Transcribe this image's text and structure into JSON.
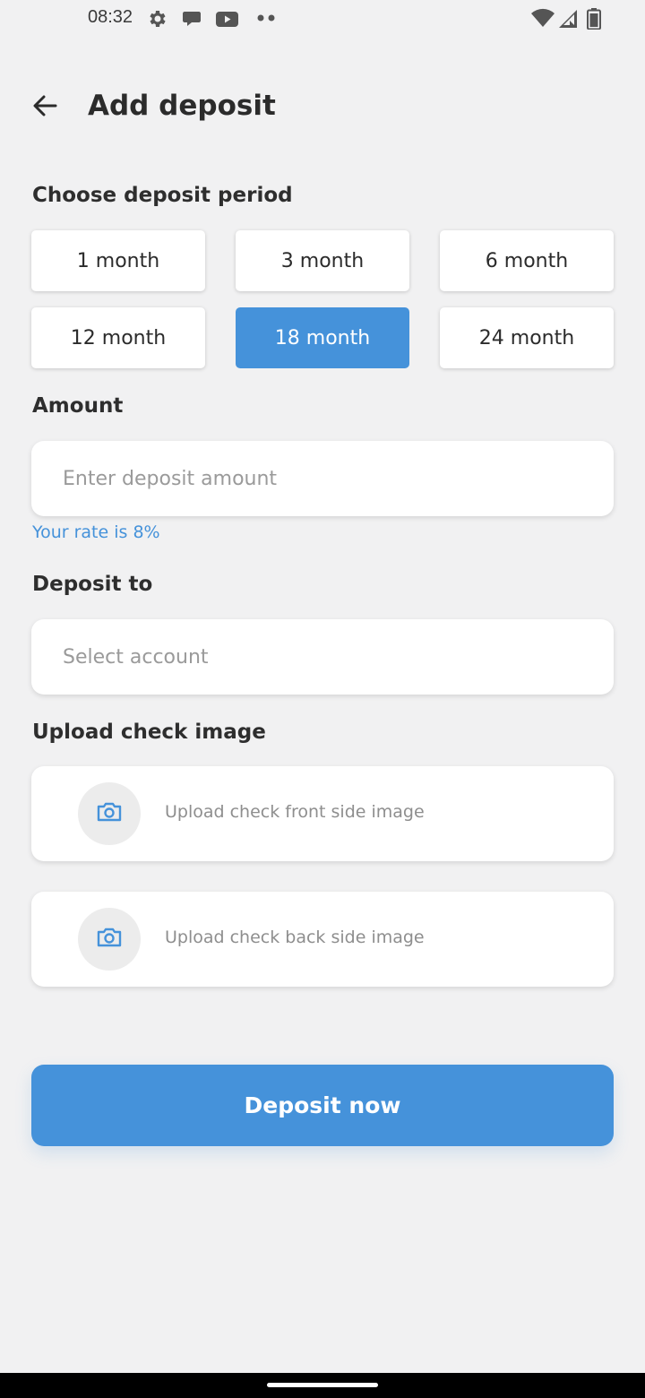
{
  "status_bar": {
    "time": "08:32",
    "left_icons": [
      "gear-icon",
      "chat-bubble-icon",
      "youtube-icon",
      "more-dots-icon"
    ],
    "right_icons": [
      "wifi-icon",
      "signal-icon",
      "battery-icon"
    ]
  },
  "header": {
    "back_icon": "arrow-left-icon",
    "title": "Add deposit"
  },
  "period": {
    "label": "Choose deposit period",
    "options": [
      "1 month",
      "3 month",
      "6 month",
      "12 month",
      "18 month",
      "24 month"
    ],
    "selected": "18 month"
  },
  "amount": {
    "label": "Amount",
    "placeholder": "Enter deposit amount",
    "value": "",
    "rate_hint": "Your rate is 8%"
  },
  "deposit_to": {
    "label": "Deposit to",
    "placeholder": "Select account"
  },
  "upload": {
    "label": "Upload check image",
    "front_text": "Upload check front side image",
    "back_text": "Upload check back side image",
    "icon": "camera-icon"
  },
  "submit": {
    "label": "Deposit now"
  },
  "colors": {
    "accent": "#4592da",
    "background": "#f1f1f2",
    "card": "#ffffff"
  }
}
